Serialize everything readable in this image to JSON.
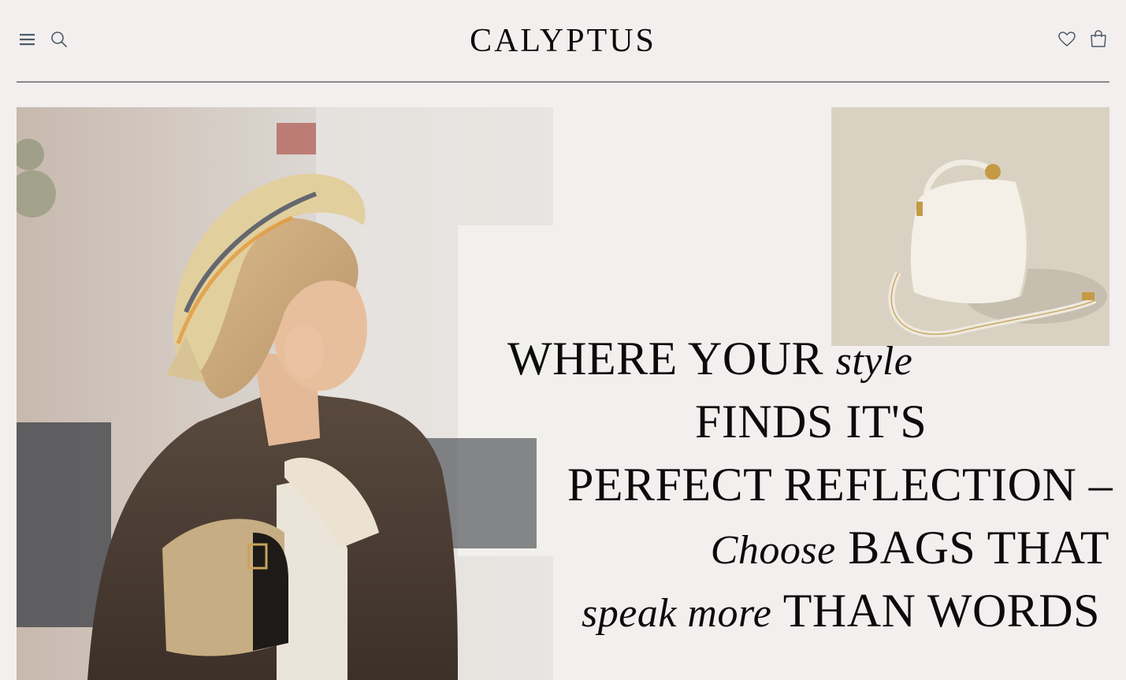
{
  "header": {
    "brand": "CALYPTUS",
    "icons": {
      "menu": "hamburger-menu-icon",
      "search": "search-icon",
      "wishlist": "heart-icon",
      "bag": "shopping-bag-icon"
    }
  },
  "hero": {
    "line1_caps": "WHERE YOUR",
    "line1_italic": "style",
    "line2_caps": "FINDS IT'S",
    "line3_caps": "PERFECT REFLECTION –",
    "line4_italic": "Choose",
    "line4_caps": "BAGS THAT",
    "line5_italic": "speak more",
    "line5_caps": "THAN WORDS"
  },
  "colors": {
    "background": "#f3efef",
    "text": "#0b0b0b",
    "divider": "#8a8a8a",
    "icon": "#4a5a66",
    "product_bg": "#d9d2c3"
  }
}
